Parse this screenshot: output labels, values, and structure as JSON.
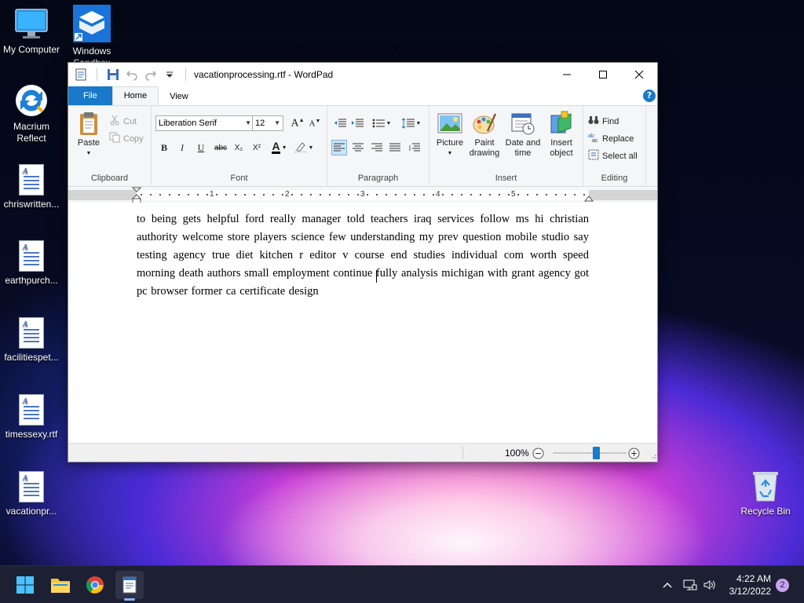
{
  "desktop": {
    "icons": [
      {
        "label": "My Computer"
      },
      {
        "label": "Windows Sandbox"
      },
      {
        "label": "Macrium Reflect"
      },
      {
        "label": "chriswritten..."
      },
      {
        "label": "earthpurch..."
      },
      {
        "label": "facilitiespet..."
      },
      {
        "label": "timessexy.rtf"
      },
      {
        "label": "vacationpr..."
      },
      {
        "label": "Recycle Bin"
      }
    ]
  },
  "window": {
    "title": "vacationprocessing.rtf - WordPad",
    "tabs": {
      "file": "File",
      "home": "Home",
      "view": "View"
    },
    "help": "?"
  },
  "ribbon": {
    "clipboard": {
      "label": "Clipboard",
      "paste": "Paste",
      "cut": "Cut",
      "copy": "Copy"
    },
    "font": {
      "label": "Font",
      "family": "Liberation Serif",
      "size": "12",
      "bold": "B",
      "italic": "I",
      "underline": "U",
      "strike": "abc",
      "sub": "X₂",
      "sup": "X²",
      "color_letter": "A"
    },
    "paragraph": {
      "label": "Paragraph"
    },
    "insert": {
      "label": "Insert",
      "picture": "Picture",
      "paint1": "Paint",
      "paint2": "drawing",
      "date1": "Date and",
      "date2": "time",
      "object1": "Insert",
      "object2": "object"
    },
    "editing": {
      "label": "Editing",
      "find": "Find",
      "replace": "Replace",
      "select_all": "Select all"
    }
  },
  "ruler": {
    "numbers": [
      "1",
      "2",
      "3",
      "4",
      "5"
    ]
  },
  "document": {
    "text": " to being  gets helpful ford really  manager   told teachers  iraq services follow  ms  hi christian authority welcome  store players  science few  understanding my prev   question  mobile  studio say testing agency true  diet kitchen r  editor  v course end   studies individual com worth speed morning death authors small  employment   continue fully    analysis  michigan with grant agency got  pc browser former ca certificate design"
  },
  "statusbar": {
    "zoom": "100%",
    "zoom_level_percent": 100
  },
  "taskbar": {
    "time": "4:22 AM",
    "date": "3/12/2022",
    "notification_count": "2"
  }
}
